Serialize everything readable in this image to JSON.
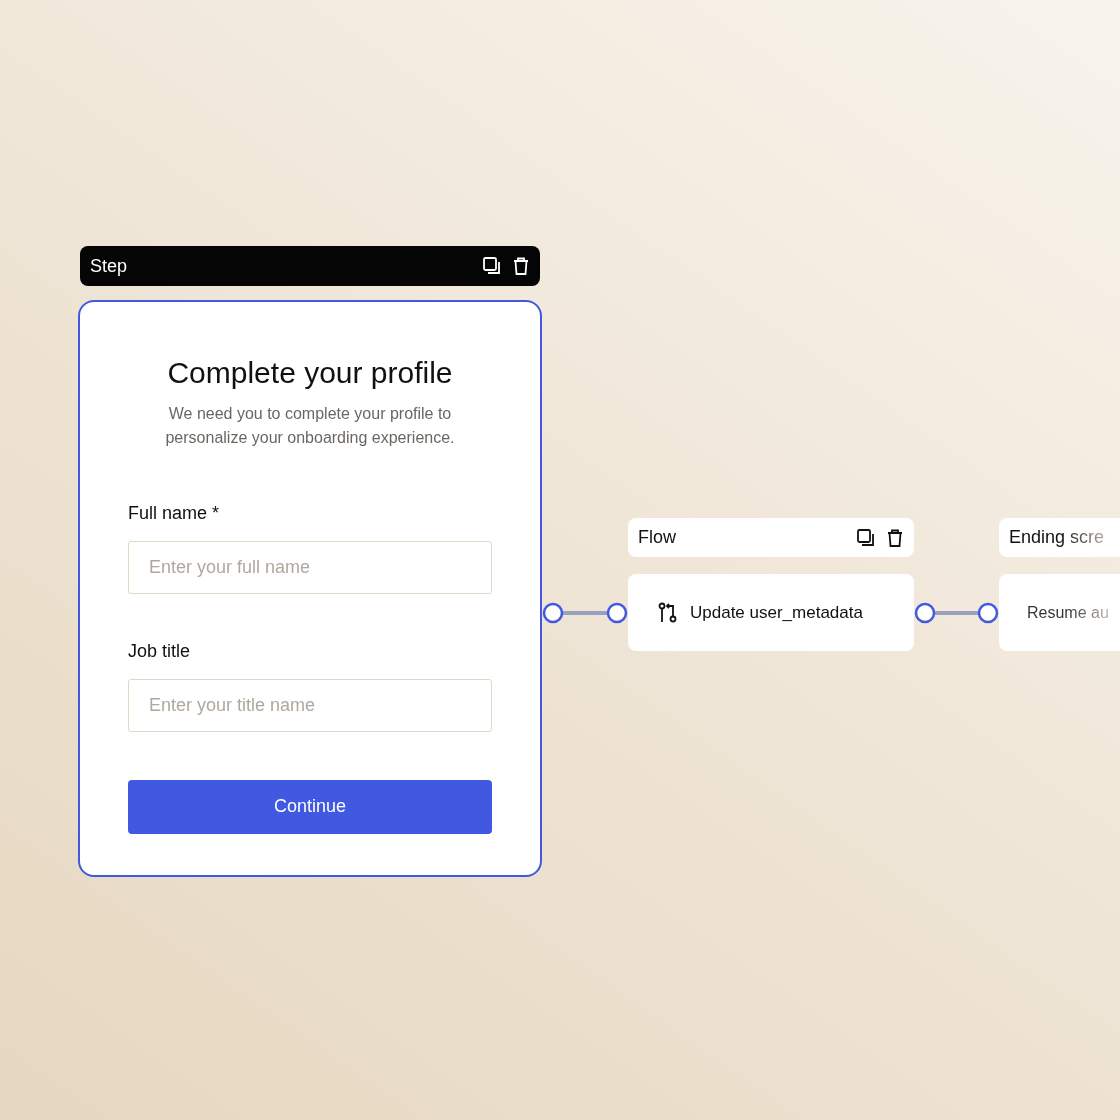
{
  "step": {
    "title": "Step",
    "form": {
      "heading": "Complete your profile",
      "description": "We need you to complete your profile to personalize your onboarding experience.",
      "fields": [
        {
          "label": "Full name *",
          "placeholder": "Enter your full name"
        },
        {
          "label": "Job title",
          "placeholder": "Enter your title name"
        }
      ],
      "button": "Continue"
    }
  },
  "flow": {
    "title": "Flow",
    "node": "Update user_metadata"
  },
  "ending": {
    "title": "Ending scre",
    "node": "Resume au"
  }
}
